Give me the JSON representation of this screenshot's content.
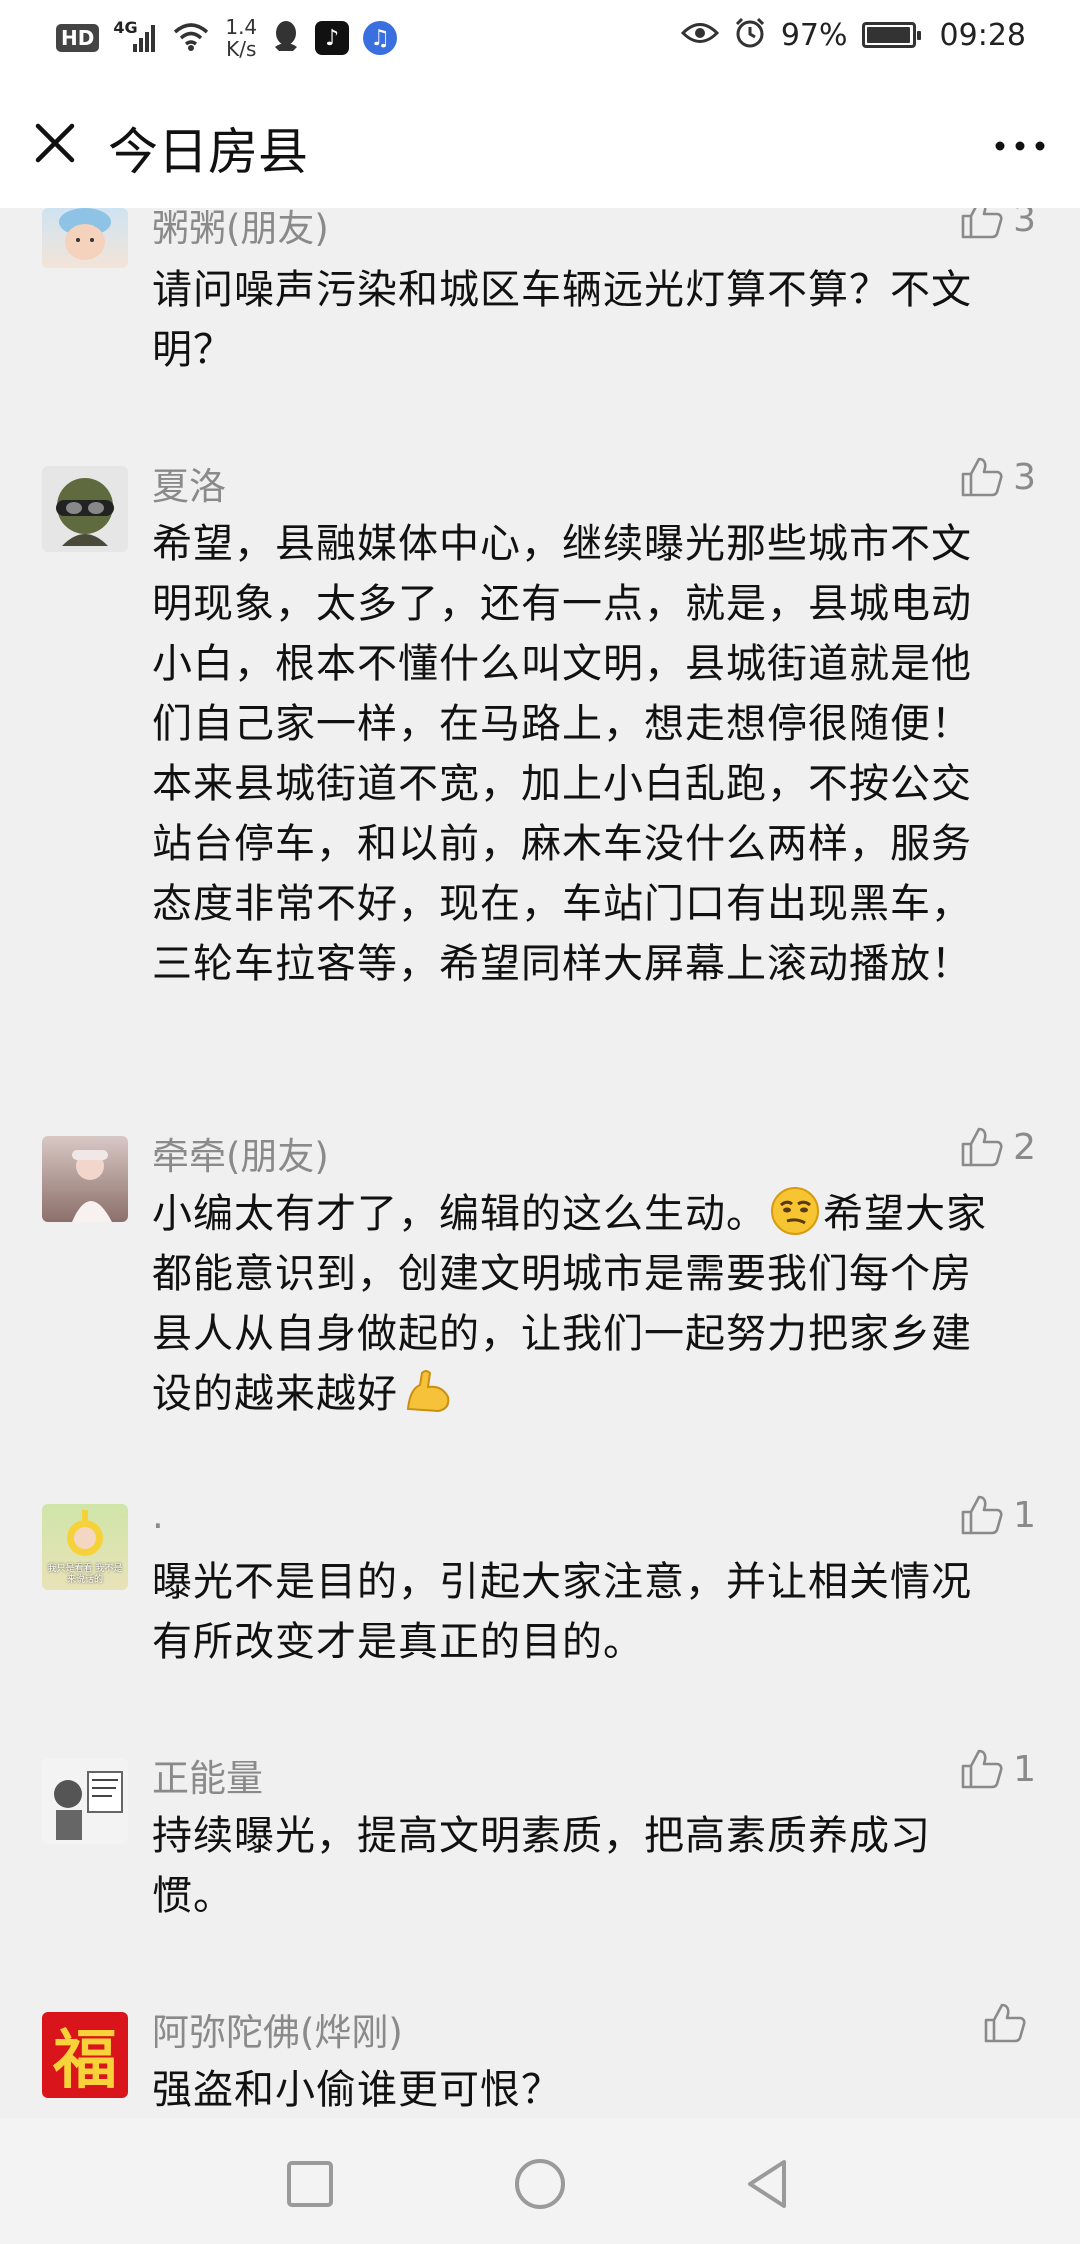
{
  "status_bar": {
    "hd": "HD",
    "network": "4G",
    "speed_value": "1.4",
    "speed_unit": "K/s",
    "battery": "97%",
    "time": "09:28",
    "battery_level": 0.97,
    "icons": [
      "signal-icon",
      "wifi-icon",
      "qq-icon",
      "tiktok-icon",
      "music-icon",
      "eye-icon",
      "alarm-icon",
      "battery-icon"
    ]
  },
  "header": {
    "title": "今日房县"
  },
  "comments": [
    {
      "name": "粥粥(朋友)",
      "likes": "3",
      "text": "请问噪声污染和城区车辆远光灯算不算？不文明？"
    },
    {
      "name": "夏洛",
      "likes": "3",
      "text": "希望，县融媒体中心，继续曝光那些城市不文明现象，太多了，还有一点，就是，县城电动小白，根本不懂什么叫文明，县城街道就是他们自己家一样，在马路上，想走想停很随便！本来县城街道不宽，加上小白乱跑，不按公交站台停车，和以前，麻木车没什么两样，服务态度非常不好，现在，车站门口有出现黑车，三轮车拉客等，希望同样大屏幕上滚动播放！"
    },
    {
      "name": "牵牵(朋友)",
      "likes": "2",
      "text_part1": "小编太有才了，编辑的这么生动。",
      "text_part2": "希望大家都能意识到，创建文明城市是需要我们每个房县人从自身做起的，让我们一起努力把家乡建设的越来越好"
    },
    {
      "name": ".",
      "likes": "1",
      "text": "曝光不是目的，引起大家注意，并让相关情况有所改变才是真正的目的。",
      "avatar_caption": "我只是看看 我不是来说话的"
    },
    {
      "name": "正能量",
      "likes": "1",
      "text": "持续曝光，提高文明素质，把高素质养成习惯。"
    },
    {
      "name": "阿弥陀佛(烨刚)",
      "likes": "",
      "text": "强盗和小偷谁更可恨？",
      "avatar_char": "福"
    }
  ],
  "colors": {
    "like_gray": "#8a8a8a",
    "fu_red": "#d9151b",
    "fu_gold": "#f7d23a"
  }
}
